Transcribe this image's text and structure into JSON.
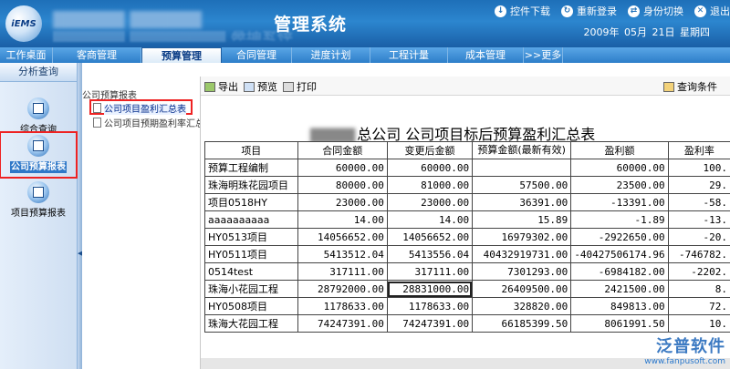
{
  "header": {
    "logo_text": "iEMS",
    "system_title": "管理系统",
    "links": [
      {
        "label": "控件下载",
        "icon": "download-icon"
      },
      {
        "label": "重新登录",
        "icon": "relogin-icon"
      },
      {
        "label": "身份切换",
        "icon": "switch-identity-icon"
      },
      {
        "label": "退出",
        "icon": "exit-icon"
      }
    ],
    "date": "2009年 05月 21日 星期四"
  },
  "nav": {
    "tabs": [
      "工作桌面",
      "客商管理",
      "预算管理",
      "合同管理",
      "进度计划",
      "工程计量",
      "成本管理",
      ">>更多"
    ],
    "active_index": 2
  },
  "left": {
    "title": "分析查询",
    "items": [
      {
        "label": "综合查询",
        "icon": "people-query-icon"
      },
      {
        "label": "公司预算报表",
        "icon": "report-icon"
      },
      {
        "label": "项目预算报表",
        "icon": "report-icon"
      }
    ]
  },
  "tree": {
    "root": "公司预算报表",
    "items": [
      "公司项目盈利汇总表",
      "公司项目预期盈利率汇总"
    ],
    "selected": 0
  },
  "toolbar": {
    "export": "导出",
    "preview": "预览",
    "print": "打印",
    "query_conditions": "查询条件"
  },
  "report": {
    "title_visible": "总公司  公司项目标后预算盈利汇总表",
    "columns": [
      "项目",
      "合同金额",
      "变更后金额",
      "预算金额(最新有效)",
      "盈利额",
      "盈利率"
    ],
    "rows": [
      [
        "预算工程编制",
        "60000.00",
        "60000.00",
        "",
        "60000.00",
        "100."
      ],
      [
        "珠海明珠花园项目",
        "80000.00",
        "81000.00",
        "57500.00",
        "23500.00",
        "29."
      ],
      [
        "项目0518HY",
        "23000.00",
        "23000.00",
        "36391.00",
        "-13391.00",
        "-58."
      ],
      [
        "aaaaaaaaaa",
        "14.00",
        "14.00",
        "15.89",
        "-1.89",
        "-13."
      ],
      [
        "HY0513项目",
        "14056652.00",
        "14056652.00",
        "16979302.00",
        "-2922650.00",
        "-20."
      ],
      [
        "HY0511项目",
        "5413512.04",
        "5413556.04",
        "40432919731.00",
        "-40427506174.96",
        "-746782."
      ],
      [
        "0514test",
        "317111.00",
        "317111.00",
        "7301293.00",
        "-6984182.00",
        "-2202."
      ],
      [
        "珠海小花园工程",
        "28792000.00",
        "28831000.00",
        "26409500.00",
        "2421500.00",
        "8."
      ],
      [
        "HY0508项目",
        "1178633.00",
        "1178633.00",
        "328820.00",
        "849813.00",
        "72."
      ],
      [
        "珠海大花园工程",
        "74247391.00",
        "74247391.00",
        "66185399.50",
        "8061991.50",
        "10."
      ]
    ]
  },
  "watermark": {
    "brand": "泛普软件",
    "url": "www.fanpusoft.com"
  },
  "colors": {
    "header": "#1e6fb8",
    "nav": "#2d7ec9",
    "highlight": "#e22222"
  }
}
